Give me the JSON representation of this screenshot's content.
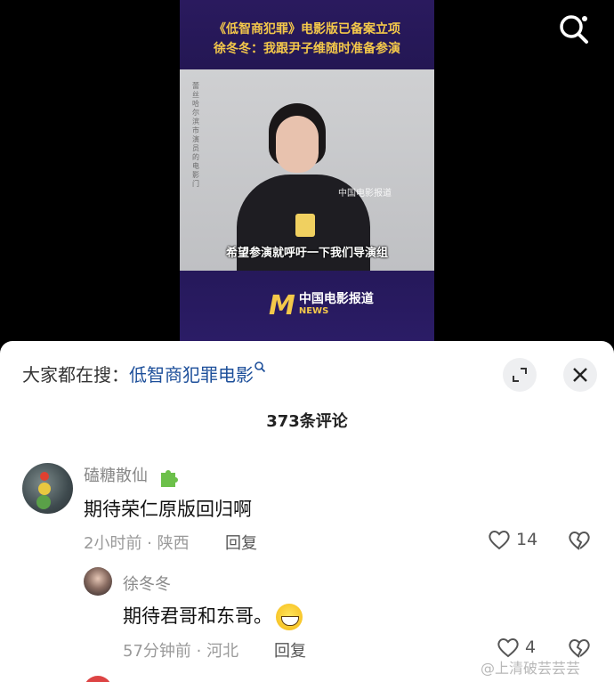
{
  "video": {
    "title_line1": "《低智商犯罪》电影版已备案立项",
    "title_line2": "徐冬冬：我跟尹子维随时准备参演",
    "vertical_text": "蕾丝哈尔滨市演员的电影门",
    "watermark": "中国电影报道",
    "subtitle": "希望参演就呼吁一下我们导演组",
    "logo_mark": "M",
    "logo_text": "中国电影报道",
    "logo_sub": "NEWS"
  },
  "search": {
    "prefix": "大家都在搜：",
    "term": "低智商犯罪电影"
  },
  "comments_count": "373条评论",
  "comments": [
    {
      "user": "磕糖散仙",
      "text": "期待荣仁原版回归啊",
      "time_location": "2小时前 · 陕西",
      "reply_label": "回复",
      "likes": "14"
    },
    {
      "user": "徐冬冬",
      "text": "期待君哥和东哥。",
      "time_location": "57分钟前 · 河北",
      "reply_label": "回复",
      "likes": "4"
    }
  ],
  "footer_watermark": "@上清破芸芸芸",
  "colors": {
    "accent_link": "#1d4f9a",
    "title_gold": "#f4c84a",
    "video_bg": "#2a1a5e"
  }
}
